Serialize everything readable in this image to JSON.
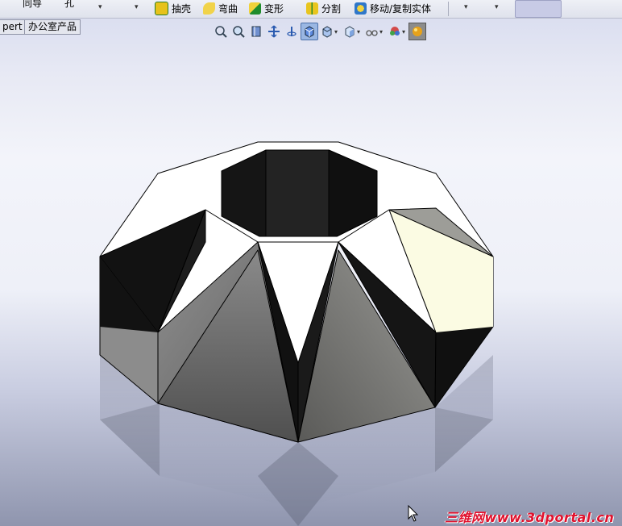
{
  "toolbar": {
    "item_1_label": "同导",
    "item_2_label": "孔",
    "shell_label": "抽壳",
    "flex_label": "弯曲",
    "deform_label": "变形",
    "split_label": "分割",
    "move_copy_label": "移动/复制实体",
    "dropdown_glyph": "▾"
  },
  "tabs": {
    "expert_label": "pert",
    "office_label": "办公室产品"
  },
  "view_toolbar": {
    "icons": [
      "zoom-to-fit-icon",
      "zoom-to-area-icon",
      "previous-view-icon",
      "pan-icon",
      "rotate-icon",
      "view-orientation-icon",
      "display-style-icon",
      "hide-show-icon",
      "edit-appearance-icon",
      "apply-scene-icon",
      "realview-icon"
    ],
    "active_icon": "view-orientation-icon"
  },
  "watermark": {
    "text": "三维网www.3dportal.cn"
  },
  "colors": {
    "face_white": "#ffffff",
    "face_black": "#141414",
    "face_gray": "#8a8a8a",
    "face_cream": "#fbfbe3",
    "accent_red": "#e0122e"
  }
}
